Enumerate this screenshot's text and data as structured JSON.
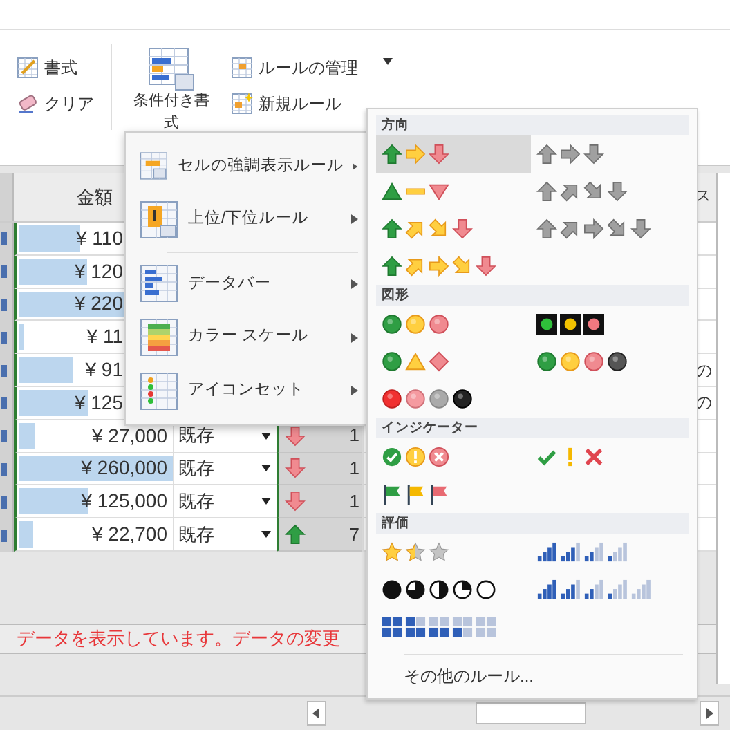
{
  "ribbon": {
    "left_buttons": [
      {
        "label": "書式",
        "kind": "format"
      },
      {
        "label": "クリア",
        "kind": "clear"
      }
    ],
    "conditional_button": {
      "label": "条件付き書式"
    },
    "rule_buttons": [
      {
        "label": "ルールの管理",
        "kind": "manage"
      },
      {
        "label": "新規ルール",
        "kind": "new"
      }
    ]
  },
  "grid": {
    "columns": [
      {
        "label": "金額",
        "kind": "amount"
      },
      {
        "label": "ス",
        "kind": "edge"
      }
    ],
    "rows": [
      {
        "amount": "¥ 110",
        "level": 0.4
      },
      {
        "amount": "¥ 120",
        "level": 0.44
      },
      {
        "amount": "¥ 220",
        "level": 0.85
      },
      {
        "amount": "¥ 11",
        "level": 0.03
      },
      {
        "amount": "¥ 91",
        "level": 0.35,
        "note": "の"
      },
      {
        "amount": "¥ 125",
        "level": 0.45,
        "note": "の"
      },
      {
        "amount": "¥ 27,000",
        "level": 0.1,
        "type": "既存",
        "trend_icon": {
          "kind": "down"
        },
        "number": "1"
      },
      {
        "amount": "¥ 260,000",
        "level": 1.0,
        "type": "既存",
        "trend_icon": {
          "kind": "down"
        },
        "number": "1"
      },
      {
        "amount": "¥ 125,000",
        "level": 0.45,
        "type": "既存",
        "trend_icon": {
          "kind": "down"
        },
        "number": "1"
      },
      {
        "amount": "¥ 22,700",
        "level": 0.09,
        "type": "既存",
        "trend_icon": {
          "kind": "up"
        },
        "number": "7"
      }
    ]
  },
  "status_message": "データを表示しています。データの変更",
  "menu": {
    "items": [
      {
        "label": "セルの強調表示ルール",
        "kind": "highlight"
      },
      {
        "label": "上位/下位ルール",
        "kind": "topbottom"
      },
      {
        "kind": "separator"
      },
      {
        "label": "データバー",
        "kind": "databar"
      },
      {
        "label": "カラー スケール",
        "kind": "colorscale"
      },
      {
        "label": "アイコンセット",
        "kind": "iconset"
      }
    ]
  },
  "submenu": {
    "sections": [
      {
        "title": "方向",
        "sets": [
          {
            "kind": "arrows3",
            "selected": true
          },
          {
            "kind": "arrows3-gray",
            "selected": false
          },
          {
            "kind": "triangles3",
            "selected": false
          },
          {
            "kind": "arrows4-gray",
            "selected": false
          },
          {
            "kind": "arrows4",
            "selected": false
          },
          {
            "kind": "arrows5-gray",
            "selected": false
          },
          {
            "kind": "arrows5",
            "selected": false
          }
        ]
      },
      {
        "title": "図形",
        "sets": [
          {
            "kind": "traffic3",
            "selected": false
          },
          {
            "kind": "traffic-boxed",
            "selected": false
          },
          {
            "kind": "signs3",
            "selected": false
          },
          {
            "kind": "traffic4",
            "selected": false
          },
          {
            "kind": "redblack4",
            "selected": false
          }
        ]
      },
      {
        "title": "インジケーター",
        "sets": [
          {
            "kind": "symbols-circled",
            "selected": false
          },
          {
            "kind": "symbols",
            "selected": false
          },
          {
            "kind": "flags3",
            "selected": false
          }
        ]
      },
      {
        "title": "評価",
        "sets": [
          {
            "kind": "stars3",
            "selected": false
          },
          {
            "kind": "bars4",
            "selected": false
          },
          {
            "kind": "quarters5",
            "selected": false
          },
          {
            "kind": "bars5",
            "selected": false
          },
          {
            "kind": "boxes5",
            "selected": false
          }
        ]
      }
    ],
    "footer": "その他のルール..."
  }
}
